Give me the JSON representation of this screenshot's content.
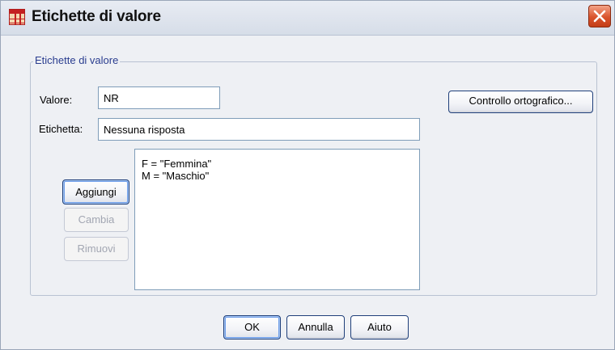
{
  "window": {
    "title": "Etichette di valore",
    "icon": "spss-grid-icon"
  },
  "group": {
    "legend": "Etichette di valore"
  },
  "value_field": {
    "label": "Valore:",
    "value": "NR"
  },
  "label_field": {
    "label": "Etichetta:",
    "value": "Nessuna risposta"
  },
  "buttons": {
    "spelling": "Controllo ortografico...",
    "add": "Aggiungi",
    "change": "Cambia",
    "remove": "Rimuovi"
  },
  "value_labels": [
    "F = \"Femmina\"",
    "M = \"Maschio\""
  ],
  "footer": {
    "ok": "OK",
    "cancel": "Annulla",
    "help": "Aiuto"
  },
  "colors": {
    "title_bar": "#d6dde8",
    "close_button": "#d9532c",
    "legend_text": "#2a3d8f"
  }
}
